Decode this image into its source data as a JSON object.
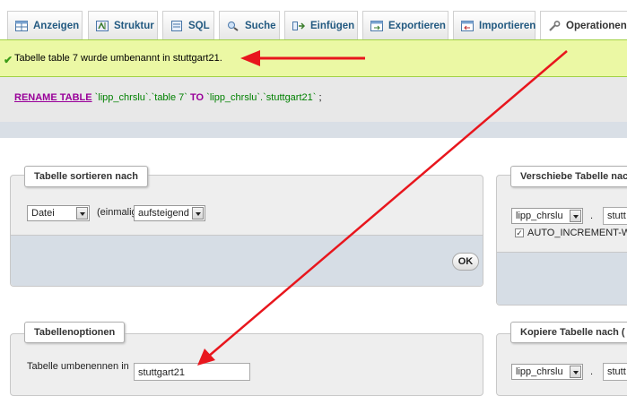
{
  "tabs": [
    {
      "label": "Anzeigen",
      "icon": "table-icon"
    },
    {
      "label": "Struktur",
      "icon": "structure-icon"
    },
    {
      "label": "SQL",
      "icon": "sql-icon"
    },
    {
      "label": "Suche",
      "icon": "search-icon"
    },
    {
      "label": "Einfügen",
      "icon": "insert-icon"
    },
    {
      "label": "Exportieren",
      "icon": "export-icon"
    },
    {
      "label": "Importieren",
      "icon": "import-icon"
    },
    {
      "label": "Operationen",
      "icon": "wrench-icon",
      "active": true
    }
  ],
  "notice": {
    "text": "Tabelle table 7 wurde umbenannt in stuttgart21."
  },
  "sql": {
    "keyword1": "RENAME TABLE",
    "part1": " `lipp_chrslu`.`table 7` ",
    "keyword2": "TO",
    "part2": " `lipp_chrslu`.`stuttgart21`",
    "semi": " ;"
  },
  "sort_panel": {
    "legend": "Tabelle sortieren nach",
    "column_value": "Datei",
    "once_label": "(einmalig)",
    "order_value": "aufsteigend",
    "ok_label": "OK"
  },
  "move_panel": {
    "legend": "Verschiebe Tabelle nac",
    "db_value": "lipp_chrslu",
    "dot": ".",
    "table_value": "stutt",
    "auto_increment_label": "AUTO_INCREMENT-W",
    "auto_increment_checked": true
  },
  "options_panel": {
    "legend": "Tabellenoptionen",
    "rename_label": "Tabelle umbenennen in",
    "rename_value": "stuttgart21"
  },
  "copy_panel": {
    "legend": "Kopiere Tabelle nach (",
    "db_value": "lipp_chrslu",
    "dot": ".",
    "table_value": "stutt"
  },
  "colors": {
    "tab_text": "#235a81",
    "notice_bg": "#ebf8a4",
    "arrow": "#e8161d",
    "sql_keyword": "#990099",
    "sql_string": "#008000"
  }
}
